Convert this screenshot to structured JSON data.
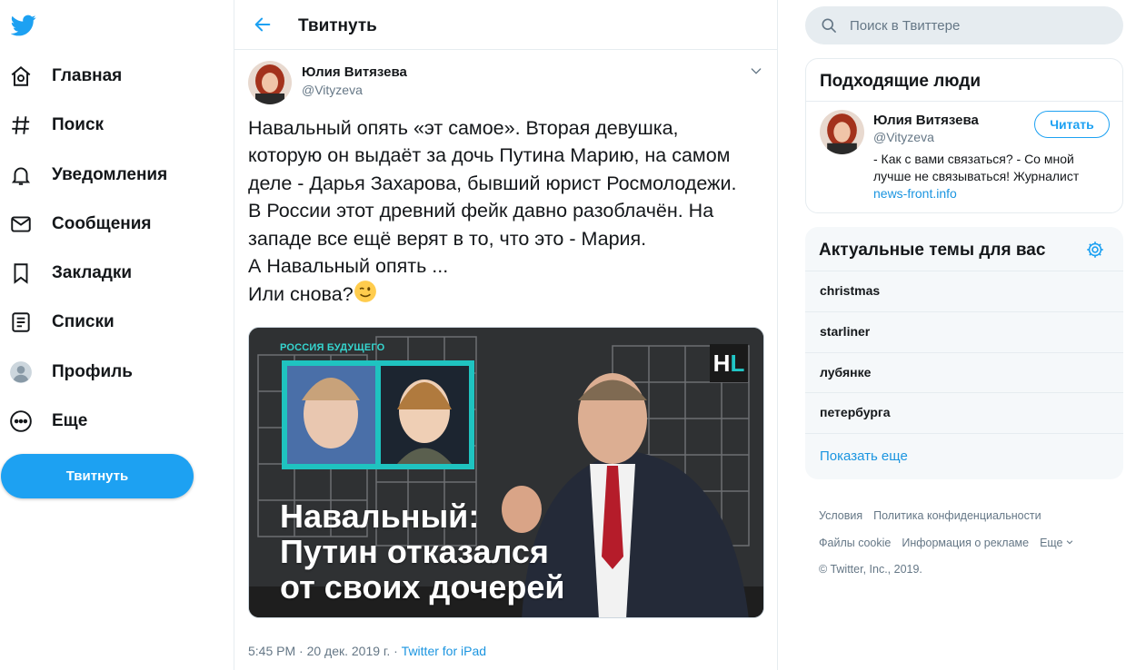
{
  "colors": {
    "brand": "#1da1f2",
    "link": "#1b95e0",
    "muted": "#657786",
    "border": "#e6ecf0"
  },
  "nav": {
    "logo": "twitter-bird-icon",
    "items": [
      {
        "label": "Главная",
        "icon": "home-icon"
      },
      {
        "label": "Поиск",
        "icon": "hashtag-icon"
      },
      {
        "label": "Уведомления",
        "icon": "bell-icon"
      },
      {
        "label": "Сообщения",
        "icon": "envelope-icon"
      },
      {
        "label": "Закладки",
        "icon": "bookmark-icon"
      },
      {
        "label": "Списки",
        "icon": "list-icon"
      },
      {
        "label": "Профиль",
        "icon": "profile-icon"
      },
      {
        "label": "Еще",
        "icon": "more-icon"
      }
    ],
    "tweet_button": "Твитнуть"
  },
  "header": {
    "title": "Твитнуть"
  },
  "tweet": {
    "author_name": "Юлия Витязева",
    "author_handle": "@Vityzeva",
    "lines": [
      "Навальный опять «эт самое». Вторая девушка,",
      "которую он выдаёт за дочь Путина Марию, на самом",
      "деле - Дарья Захарова, бывший юрист Росмолодежи.",
      "В России этот древний фейк давно разоблачён. На",
      "западе все ещё верят в то, что это - Мария.",
      "А Навальный опять ...",
      "Или снова?"
    ],
    "media": {
      "kicker": "РОССИЯ БУДУЩЕГО",
      "logo_h": "H",
      "logo_l": "L",
      "headline": [
        "Навальный:",
        "Путин отказался",
        "от своих дочерей"
      ]
    },
    "time": "5:45 PM · 20 дек. 2019 г. · ",
    "source": "Twitter for iPad"
  },
  "search": {
    "placeholder": "Поиск в Твиттере"
  },
  "people": {
    "title": "Подходящие люди",
    "name": "Юлия Витязева",
    "handle": "@Vityzeva",
    "bio_1": "- Как с вами связаться? - Со мной",
    "bio_2": "лучше не связываться! Журналист",
    "bio_link": "news-front.info",
    "follow_label": "Читать"
  },
  "trends": {
    "title": "Актуальные темы для вас",
    "items": [
      "christmas",
      "starliner",
      "лубянке",
      "петербурга"
    ],
    "show_more": "Показать еще"
  },
  "footer": {
    "row1": [
      "Условия",
      "Политика конфиденциальности"
    ],
    "row2": [
      "Файлы cookie",
      "Информация о рекламе",
      "Еще"
    ],
    "copyright": "© Twitter, Inc., 2019."
  }
}
